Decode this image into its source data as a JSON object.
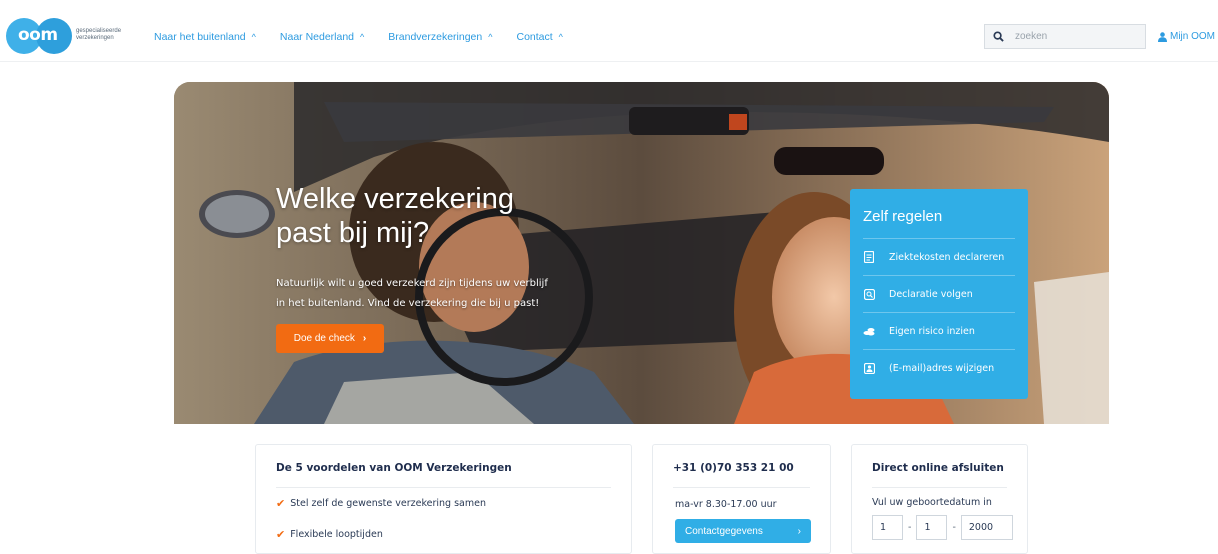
{
  "logo": {
    "mark": "oom",
    "subtitle_line1": "gespecialiseerde",
    "subtitle_line2": "verzekeringen"
  },
  "nav": {
    "items": [
      {
        "label": "Naar het buitenland"
      },
      {
        "label": "Naar Nederland"
      },
      {
        "label": "Brandverzekeringen"
      },
      {
        "label": "Contact"
      }
    ],
    "caret": "^"
  },
  "search": {
    "placeholder": "zoeken"
  },
  "account": {
    "label": "Mijn OOM"
  },
  "hero": {
    "heading_line1": "Welke verzekering",
    "heading_line2": "past bij mij?",
    "body_line1": "Natuurlijk wilt u goed verzekerd zijn tijdens uw verblijf",
    "body_line2": "in het buitenland. Vind de verzekering die bij u past!",
    "cta_label": "Doe de check",
    "cta_arrow": "›"
  },
  "self_service": {
    "title": "Zelf regelen",
    "items": [
      {
        "label": "Ziektekosten declareren",
        "icon": "document-icon"
      },
      {
        "label": "Declaratie volgen",
        "icon": "tracking-icon"
      },
      {
        "label": "Eigen risico inzien",
        "icon": "coins-icon"
      },
      {
        "label": "(E-mail)adres wijzigen",
        "icon": "address-card-icon"
      }
    ]
  },
  "benefits": {
    "title": "De 5 voordelen van OOM Verzekeringen",
    "items": [
      "Stel zelf de gewenste verzekering samen",
      "Flexibele looptijden"
    ]
  },
  "contact": {
    "phone": "+31 (0)70 353 21 00",
    "hours": "ma-vr 8.30-17.00 uur",
    "button_label": "Contactgegevens",
    "button_arrow": "›"
  },
  "direct": {
    "title": "Direct online afsluiten",
    "label": "Vul uw geboortedatum in",
    "day": "1",
    "month": "1",
    "year": "2000",
    "separator": "-"
  },
  "colors": {
    "primary_blue": "#30aee6",
    "link_blue": "#2d9be0",
    "accent_orange": "#f26b12",
    "text_navy": "#1f2d4d"
  }
}
